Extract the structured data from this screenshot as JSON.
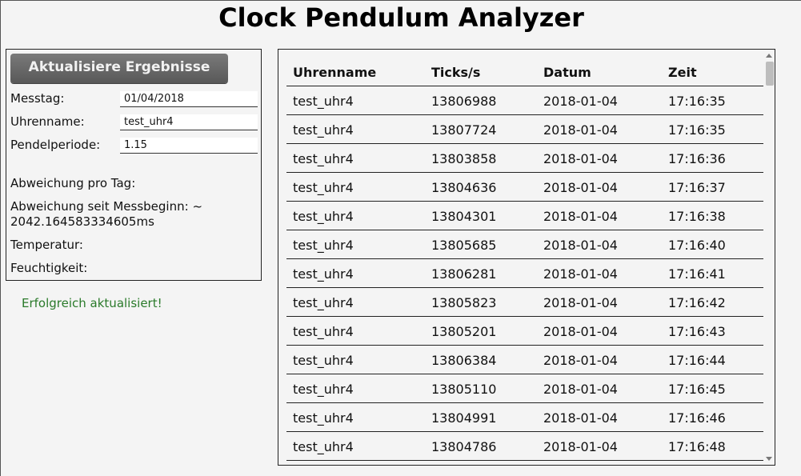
{
  "title": "Clock Pendulum Analyzer",
  "form": {
    "update_button": "Aktualisiere Ergebnisse",
    "messtag_label": "Messtag:",
    "messtag_value": "01/04/2018",
    "uhrenname_label": "Uhrenname:",
    "uhrenname_value": "test_uhr4",
    "pendelperiode_label": "Pendelperiode:",
    "pendelperiode_value": "1.15"
  },
  "stats": {
    "abweichung_tag": "Abweichung pro Tag:",
    "abweichung_seit": "Abweichung seit Messbeginn: ~ 2042.164583334605ms",
    "temperatur": "Temperatur:",
    "feuchtigkeit": "Feuchtigkeit:"
  },
  "status_message": "Erfolgreich aktualisiert!",
  "table": {
    "columns": [
      "Uhrenname",
      "Ticks/s",
      "Datum",
      "Zeit"
    ],
    "rows": [
      [
        "test_uhr4",
        "13806988",
        "2018-01-04",
        "17:16:35"
      ],
      [
        "test_uhr4",
        "13807724",
        "2018-01-04",
        "17:16:35"
      ],
      [
        "test_uhr4",
        "13803858",
        "2018-01-04",
        "17:16:36"
      ],
      [
        "test_uhr4",
        "13804636",
        "2018-01-04",
        "17:16:37"
      ],
      [
        "test_uhr4",
        "13804301",
        "2018-01-04",
        "17:16:38"
      ],
      [
        "test_uhr4",
        "13805685",
        "2018-01-04",
        "17:16:40"
      ],
      [
        "test_uhr4",
        "13806281",
        "2018-01-04",
        "17:16:41"
      ],
      [
        "test_uhr4",
        "13805823",
        "2018-01-04",
        "17:16:42"
      ],
      [
        "test_uhr4",
        "13805201",
        "2018-01-04",
        "17:16:43"
      ],
      [
        "test_uhr4",
        "13806384",
        "2018-01-04",
        "17:16:44"
      ],
      [
        "test_uhr4",
        "13805110",
        "2018-01-04",
        "17:16:45"
      ],
      [
        "test_uhr4",
        "13804991",
        "2018-01-04",
        "17:16:46"
      ],
      [
        "test_uhr4",
        "13804786",
        "2018-01-04",
        "17:16:48"
      ]
    ]
  }
}
